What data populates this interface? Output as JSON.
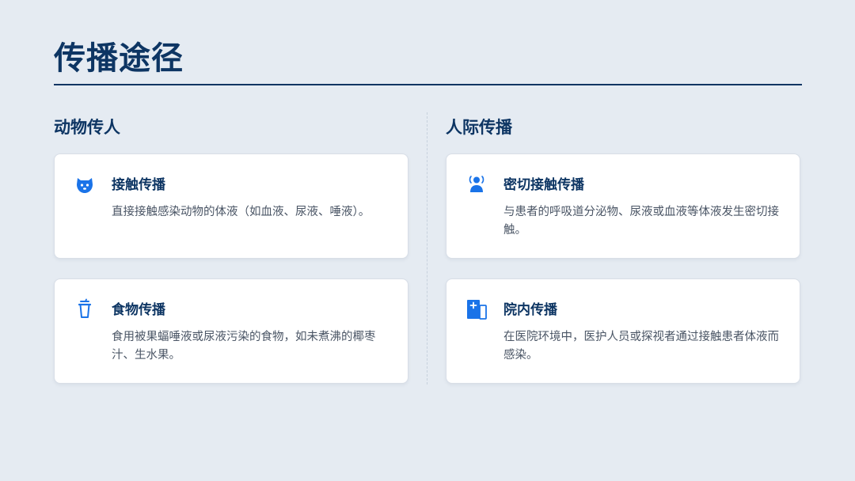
{
  "page": {
    "title": "传播途径"
  },
  "sections": [
    {
      "heading": "动物传人",
      "cards": [
        {
          "icon": "dog-face-icon",
          "title": "接触传播",
          "desc": "直接接触感染动物的体液（如血液、尿液、唾液）。"
        },
        {
          "icon": "cup-icon",
          "title": "食物传播",
          "desc": "食用被果蝠唾液或尿液污染的食物，如未煮沸的椰枣汁、生水果。"
        }
      ]
    },
    {
      "heading": "人际传播",
      "cards": [
        {
          "icon": "person-contact-icon",
          "title": "密切接触传播",
          "desc": "与患者的呼吸道分泌物、尿液或血液等体液发生密切接触。"
        },
        {
          "icon": "hospital-icon",
          "title": "院内传播",
          "desc": "在医院环境中，医护人员或探视者通过接触患者体液而感染。"
        }
      ]
    }
  ],
  "colors": {
    "background": "#e5ebf2",
    "heading": "#0d3563",
    "icon_accent": "#1a73e8",
    "body_text": "#4a5565"
  }
}
